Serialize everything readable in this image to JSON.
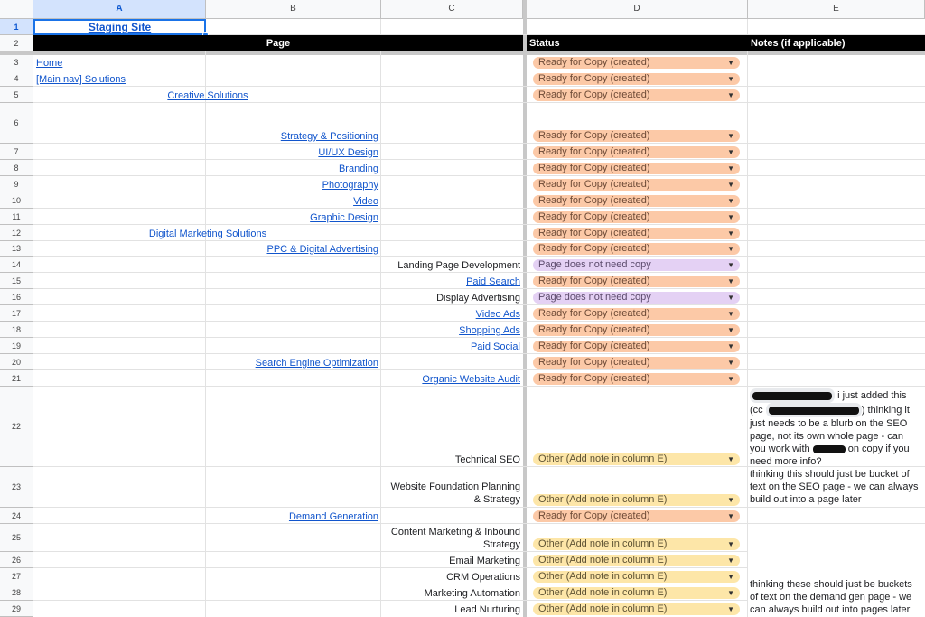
{
  "columns": [
    "A",
    "B",
    "C",
    "D",
    "E"
  ],
  "selected_column": "A",
  "selected_row": "1",
  "row_numbers": [
    "1",
    "2",
    "3",
    "4",
    "5",
    "6",
    "7",
    "8",
    "9",
    "10",
    "11",
    "12",
    "13",
    "14",
    "15",
    "16",
    "17",
    "18",
    "19",
    "20",
    "21",
    "22",
    "23",
    "24",
    "25",
    "26",
    "27",
    "28",
    "29"
  ],
  "cells": {
    "a1": "Staging Site",
    "header_page": "Page",
    "header_status": "Status",
    "header_notes": "Notes (if applicable)",
    "r3": "Home",
    "r4": "[Main nav] Solutions",
    "r5": "Creative Solutions",
    "r6": "Strategy & Positioning",
    "r7": "UI/UX Design",
    "r8": "Branding",
    "r9": "Photography",
    "r10": "Video",
    "r11": "Graphic Design",
    "r12": "Digital Marketing Solutions",
    "r13": "PPC & Digital Advertising",
    "r14": "Landing Page Development",
    "r15": "Paid Search",
    "r16": "Display Advertising",
    "r17": "Video Ads",
    "r18": "Shopping Ads",
    "r19": "Paid Social",
    "r20": "Search Engine Optimization",
    "r21": "Organic Website Audit",
    "r22": "Technical SEO",
    "r23_line1": "Website Foundation Planning",
    "r23_line2": "& Strategy",
    "r24": "Demand Generation",
    "r25_line1": "Content Marketing & Inbound",
    "r25_line2": "Strategy",
    "r26": "Email Marketing",
    "r27": "CRM Operations",
    "r28": "Marketing Automation",
    "r29": "Lead Nurturing"
  },
  "status": {
    "ready": "Ready for Copy (created)",
    "nocopy": "Page does not need copy",
    "other": "Other (Add note in column E)",
    "dropdown_arrow": "▼"
  },
  "notes": {
    "n22_a": "i just added this",
    "n22_b": "(cc",
    "n22_c": ") thinking it",
    "n22_d": "just needs to be a blurb on the SEO",
    "n22_e": "page, not its own whole page - can",
    "n22_f": "you work with",
    "n22_g": "on copy if you",
    "n22_h": "need more info?",
    "n23_a": "thinking this should just be bucket of",
    "n23_b": "text on the SEO page - we can always",
    "n23_c": "build out into a page later",
    "n28_a": "thinking these should just be buckets",
    "n28_b": "of text on the demand gen page - we",
    "n28_c": "can always build out into pages later"
  },
  "colors": {
    "ready": "#fcc9a7",
    "nocopy": "#e4d1f4",
    "other": "#fde6a8",
    "header_bg": "#000000",
    "link": "#1155cc",
    "selection": "#1a73e8"
  }
}
